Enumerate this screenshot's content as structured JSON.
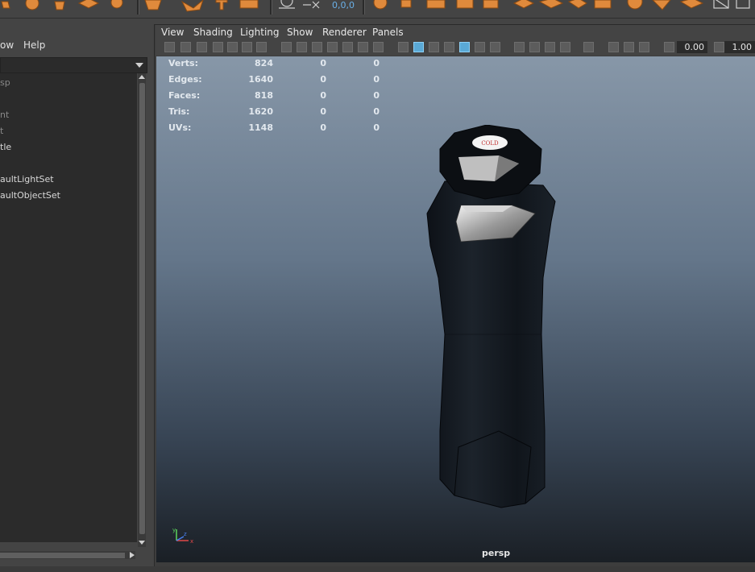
{
  "shelf": {
    "coord_value": "0,0,0",
    "icons": [
      "cube-icon",
      "sphere-icon",
      "rotate-icon",
      "extrude-icon",
      "bevel-icon",
      "snap-icon",
      "curve-tool-icon",
      "text-tool-icon",
      "paint-icon",
      "camera-icon",
      "move-xform-icon",
      "poly-cube-icon",
      "poly-plane-icon",
      "poly-grid-icon",
      "poly-disc-icon",
      "uv-layout-icon",
      "bridge-icon",
      "combine-icon",
      "target-icon"
    ],
    "accent_color": "#e08a3c"
  },
  "outliner": {
    "menu": {
      "show": "ow",
      "help": "Help"
    },
    "items": [
      {
        "label": "sp",
        "dim": true
      },
      {
        "label": "nt",
        "dim": true
      },
      {
        "label": "t",
        "dim": true
      },
      {
        "label": "tle",
        "dim": false
      },
      {
        "label": "aultLightSet",
        "dim": false
      },
      {
        "label": "aultObjectSet",
        "dim": false
      }
    ]
  },
  "panel": {
    "menu": [
      "View",
      "Shading",
      "Lighting",
      "Show",
      "Renderer",
      "Panels"
    ],
    "toolbar": {
      "field1": "0.00",
      "field2": "1.00",
      "icons": [
        "select-camera-icon",
        "camera-attributes-icon",
        "bookmark-icon",
        "image-plane-icon",
        "grease-pencil-icon",
        "2d-pan-zoom-icon",
        "grid-icon",
        "film-gate-icon",
        "resolution-gate-icon",
        "gate-mask-icon",
        "field-chart-icon",
        "safe-action-icon",
        "safe-title-icon",
        "wireframe-icon",
        "smooth-shade-icon",
        "default-material-icon",
        "wireframe-on-shaded-icon",
        "xray-icon",
        "xray-joints-icon",
        "use-lights-icon",
        "shadows-icon",
        "ambient-occlusion-icon",
        "motion-blur-icon",
        "anti-aliasing-icon",
        "depth-of-field-icon",
        "isolate-select-icon",
        "xray-active-icon",
        "gamma-icon",
        "exposure-icon"
      ]
    }
  },
  "hud": {
    "rows": [
      {
        "label": "Verts:",
        "v1": "824",
        "v2": "0",
        "v3": "0"
      },
      {
        "label": "Edges:",
        "v1": "1640",
        "v2": "0",
        "v3": "0"
      },
      {
        "label": "Faces:",
        "v1": "818",
        "v2": "0",
        "v3": "0"
      },
      {
        "label": "Tris:",
        "v1": "1620",
        "v2": "0",
        "v3": "0"
      },
      {
        "label": "UVs:",
        "v1": "1148",
        "v2": "0",
        "v3": "0"
      }
    ]
  },
  "viewport": {
    "camera_label": "persp",
    "cap_label": "COLD",
    "axis": {
      "x": "x",
      "y": "y",
      "z": "z"
    }
  }
}
